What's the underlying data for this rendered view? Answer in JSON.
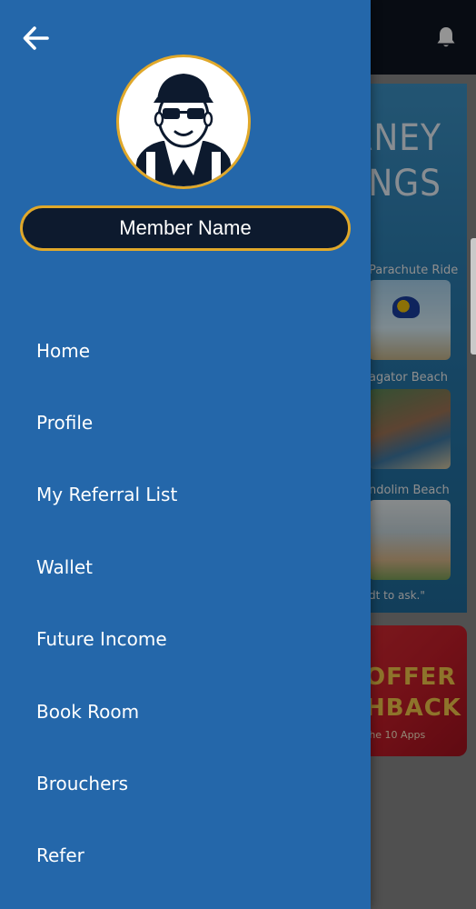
{
  "background": {
    "topbar": {
      "icon": "bell-icon"
    },
    "poster": {
      "title_line1": "RNEY",
      "title_line2": "INGS",
      "items": [
        {
          "caption": "Parachute Ride"
        },
        {
          "caption": "agator Beach"
        },
        {
          "caption": "ndolim Beach"
        }
      ],
      "quote": "dt to ask.\""
    },
    "offer": {
      "line1": "OFFER",
      "line2": "HBACK",
      "sub": "the 10 Apps"
    }
  },
  "drawer": {
    "back_icon": "back-arrow-icon",
    "member_name": "Member Name",
    "menu": [
      {
        "label": "Home"
      },
      {
        "label": "Profile"
      },
      {
        "label": "My Referral List"
      },
      {
        "label": "Wallet"
      },
      {
        "label": "Future Income"
      },
      {
        "label": "Book Room"
      },
      {
        "label": "Brouchers"
      },
      {
        "label": "Refer"
      }
    ]
  },
  "colors": {
    "drawer_bg": "#2467aa",
    "accent_gold": "#e0a82a",
    "pill_bg": "#0d1a2e",
    "topbar_bg": "#0f1522"
  }
}
